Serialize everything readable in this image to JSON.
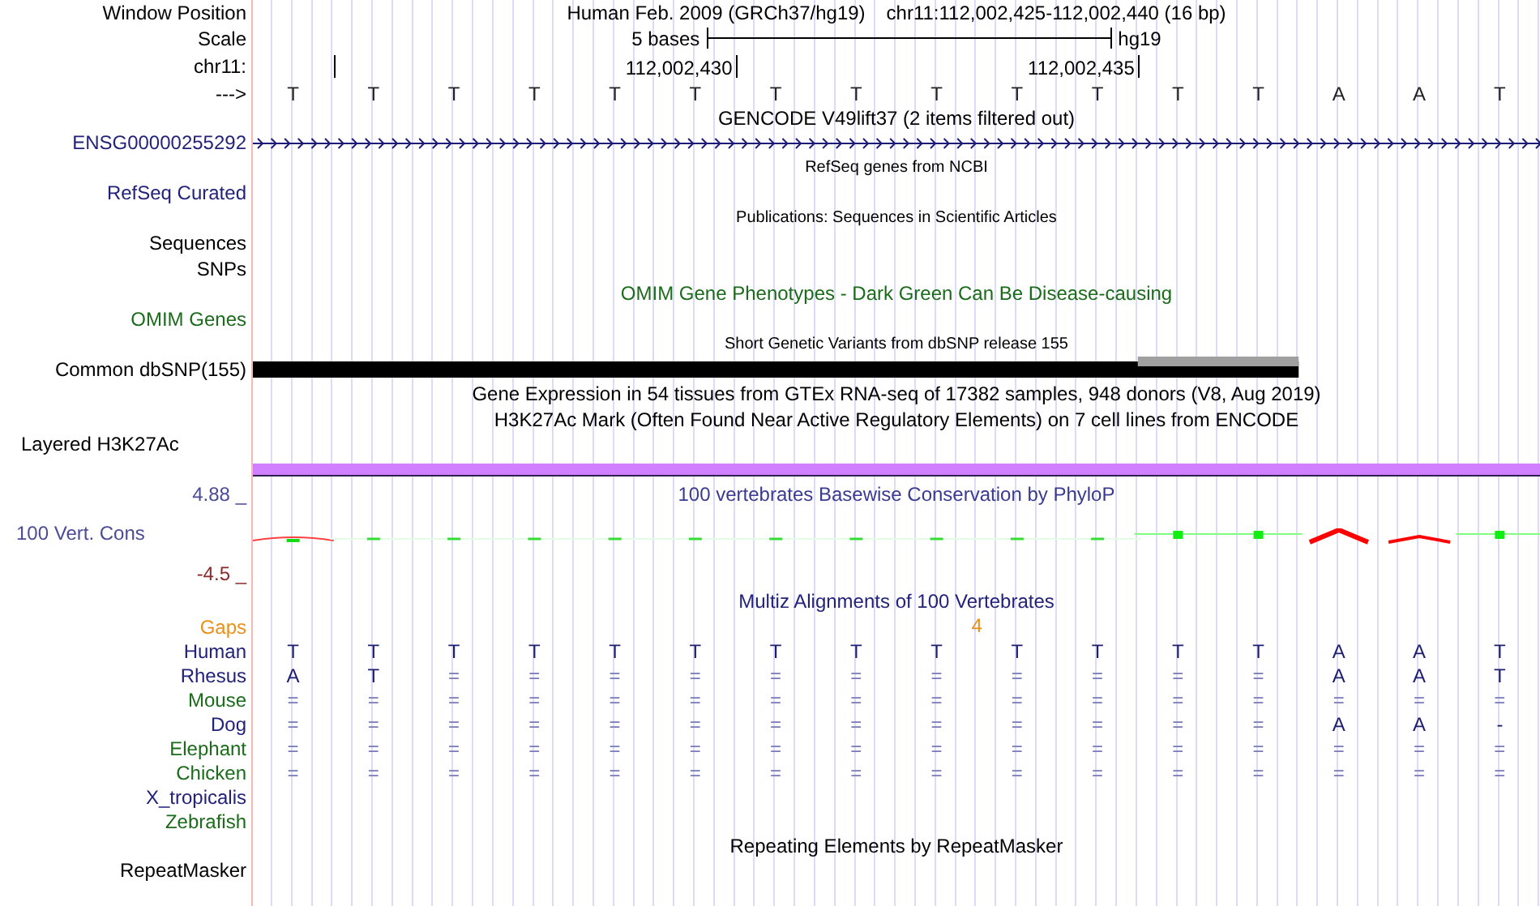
{
  "header": {
    "labels": [
      "Window Position",
      "Scale",
      "chr11:",
      "--->"
    ],
    "assembly": "Human Feb. 2009 (GRCh37/hg19)",
    "position": "chr11:112,002,425-112,002,440 (16 bp)",
    "scale_text": "5 bases",
    "scale_assembly": "hg19",
    "coordinate_labels": [
      "112,002,430",
      "112,002,435"
    ]
  },
  "bases": [
    "T",
    "T",
    "T",
    "T",
    "T",
    "T",
    "T",
    "T",
    "T",
    "T",
    "T",
    "T",
    "T",
    "A",
    "A",
    "T"
  ],
  "rows": [
    {
      "kind": "title",
      "text": "GENCODE V49lift37 (2 items filtered out)"
    },
    {
      "kind": "gene",
      "label": "ENSG00000255292",
      "color": "#22227a"
    },
    {
      "kind": "subtitle",
      "text": "RefSeq genes from NCBI"
    },
    {
      "kind": "blank",
      "label": "RefSeq Curated",
      "color": "#22227a"
    },
    {
      "kind": "subtitle",
      "text": "Publications: Sequences in Scientific Articles"
    },
    {
      "kind": "blank",
      "label": "Sequences"
    },
    {
      "kind": "blank",
      "label": "SNPs"
    },
    {
      "kind": "title",
      "text": "OMIM Gene Phenotypes - Dark Green Can Be Disease-causing",
      "color": "#1a6b1a"
    },
    {
      "kind": "blank",
      "label": "OMIM Genes",
      "color": "#1a6b1a"
    },
    {
      "kind": "subtitle",
      "text": "Short Genetic Variants from dbSNP release 155"
    },
    {
      "kind": "snp",
      "label": "Common dbSNP(155)"
    },
    {
      "kind": "title",
      "text": "Gene Expression in 54 tissues from GTEx RNA-seq of 17382 samples, 948 donors (V8, Aug 2019)"
    },
    {
      "kind": "title",
      "text": "H3K27Ac Mark (Often Found Near Active Regulatory Elements) on 7 cell lines from ENCODE"
    },
    {
      "kind": "layered_label",
      "label": "Layered H3K27Ac"
    },
    {
      "kind": "signal_bar"
    },
    {
      "kind": "wiggle",
      "title": "100 vertebrates Basewise Conservation by PhyloP",
      "label": "100 Vert. Cons",
      "max_label": "4.88 _",
      "min_label": "-4.5 _"
    },
    {
      "kind": "title",
      "text": "Multiz Alignments of 100 Vertebrates",
      "color": "#22227a"
    },
    {
      "kind": "gaps",
      "label": "Gaps",
      "color": "#e8901a",
      "gaps": [
        "4"
      ]
    },
    {
      "kind": "alignment",
      "label": "Human",
      "color": "#22227a",
      "bases": [
        "T",
        "T",
        "T",
        "T",
        "T",
        "T",
        "T",
        "T",
        "T",
        "T",
        "T",
        "T",
        "T",
        "A",
        "A",
        "T"
      ]
    },
    {
      "kind": "alignment",
      "label": "Rhesus",
      "color": "#22227a",
      "bases": [
        "A",
        "T",
        "=",
        "=",
        "=",
        "=",
        "=",
        "=",
        "=",
        "=",
        "=",
        "=",
        "=",
        "A",
        "A",
        "T"
      ]
    },
    {
      "kind": "alignment",
      "label": "Mouse",
      "color": "#1a6b1a",
      "bases": [
        "=",
        "=",
        "=",
        "=",
        "=",
        "=",
        "=",
        "=",
        "=",
        "=",
        "=",
        "=",
        "=",
        "=",
        "=",
        "="
      ]
    },
    {
      "kind": "alignment",
      "label": "Dog",
      "color": "#22227a",
      "bases": [
        "=",
        "=",
        "=",
        "=",
        "=",
        "=",
        "=",
        "=",
        "=",
        "=",
        "=",
        "=",
        "=",
        "A",
        "A",
        "-"
      ]
    },
    {
      "kind": "alignment",
      "label": "Elephant",
      "color": "#1a6b1a",
      "bases": [
        "=",
        "=",
        "=",
        "=",
        "=",
        "=",
        "=",
        "=",
        "=",
        "=",
        "=",
        "=",
        "=",
        "=",
        "=",
        "="
      ]
    },
    {
      "kind": "alignment",
      "label": "Chicken",
      "color": "#1a6b1a",
      "bases": [
        "=",
        "=",
        "=",
        "=",
        "=",
        "=",
        "=",
        "=",
        "=",
        "=",
        "=",
        "=",
        "=",
        "=",
        "=",
        "="
      ]
    },
    {
      "kind": "alignment",
      "label": "X_tropicalis",
      "color": "#22227a"
    },
    {
      "kind": "alignment",
      "label": "Zebrafish",
      "color": "#1a6b1a"
    },
    {
      "kind": "title",
      "text": "Repeating Elements by RepeatMasker"
    },
    {
      "kind": "blank",
      "label": "RepeatMasker"
    }
  ]
}
